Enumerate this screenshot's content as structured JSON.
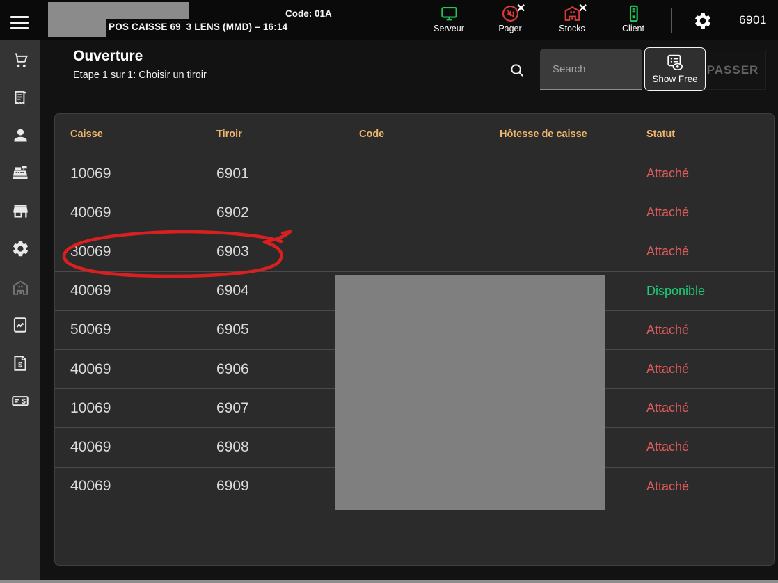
{
  "topbar": {
    "pos_title": "POS CAISSE 69_3 LENS (MMD) – 16:14",
    "code_label": "Code: 01A",
    "station_number": "6901",
    "status_icons": [
      {
        "label": "Serveur",
        "icon": "monitor-icon",
        "state": "ok",
        "color": "#22c55e"
      },
      {
        "label": "Pager",
        "icon": "pager-icon",
        "state": "error",
        "color": "#d93a3a"
      },
      {
        "label": "Stocks",
        "icon": "warehouse-icon",
        "state": "error",
        "color": "#d93a3a"
      },
      {
        "label": "Client",
        "icon": "terminal-icon",
        "state": "ok",
        "color": "#22c55e"
      }
    ],
    "error_badge_glyph": "✕"
  },
  "page": {
    "title": "Ouverture",
    "subtitle": "Etape 1 sur 1: Choisir un tiroir"
  },
  "toolbar": {
    "search_placeholder": "Search",
    "show_free_label": "Show Free",
    "passer_label": "PASSER"
  },
  "table": {
    "columns": [
      "Caisse",
      "Tiroir",
      "Code",
      "Hôtesse de caisse",
      "Statut"
    ],
    "rows": [
      {
        "caisse": "10069",
        "tiroir": "6901",
        "code": "",
        "hotesse": "",
        "statut": "Attaché"
      },
      {
        "caisse": "40069",
        "tiroir": "6902",
        "code": "",
        "hotesse": "",
        "statut": "Attaché"
      },
      {
        "caisse": "30069",
        "tiroir": "6903",
        "code": "",
        "hotesse": "",
        "statut": "Attaché"
      },
      {
        "caisse": "40069",
        "tiroir": "6904",
        "code": "",
        "hotesse": "",
        "statut": "Disponible"
      },
      {
        "caisse": "50069",
        "tiroir": "6905",
        "code": "",
        "hotesse": "",
        "statut": "Attaché"
      },
      {
        "caisse": "40069",
        "tiroir": "6906",
        "code": "",
        "hotesse": "",
        "statut": "Attaché"
      },
      {
        "caisse": "10069",
        "tiroir": "6907",
        "code": "",
        "hotesse": "",
        "statut": "Attaché"
      },
      {
        "caisse": "40069",
        "tiroir": "6908",
        "code": "",
        "hotesse": "",
        "statut": "Attaché"
      },
      {
        "caisse": "40069",
        "tiroir": "6909",
        "code": "",
        "hotesse": "",
        "statut": "Attaché"
      }
    ],
    "status_colors": {
      "Attaché": "#df5b5b",
      "Disponible": "#1ec977"
    },
    "header_color": "#efb66c"
  },
  "sidebar": {
    "items": [
      "cart",
      "receipt",
      "customer",
      "cash-register",
      "store",
      "settings",
      "warehouse",
      "report",
      "invoice",
      "cheque"
    ]
  },
  "annotation": {
    "circled_row": "30069 6903",
    "circle_color": "#d92020"
  },
  "colors": {
    "topbar_bg": "#0a0a0a",
    "sidebar_bg": "#343434",
    "main_bg": "#121212",
    "card_bg": "#2b2b2b",
    "redaction_gray": "#7f7f7f"
  }
}
